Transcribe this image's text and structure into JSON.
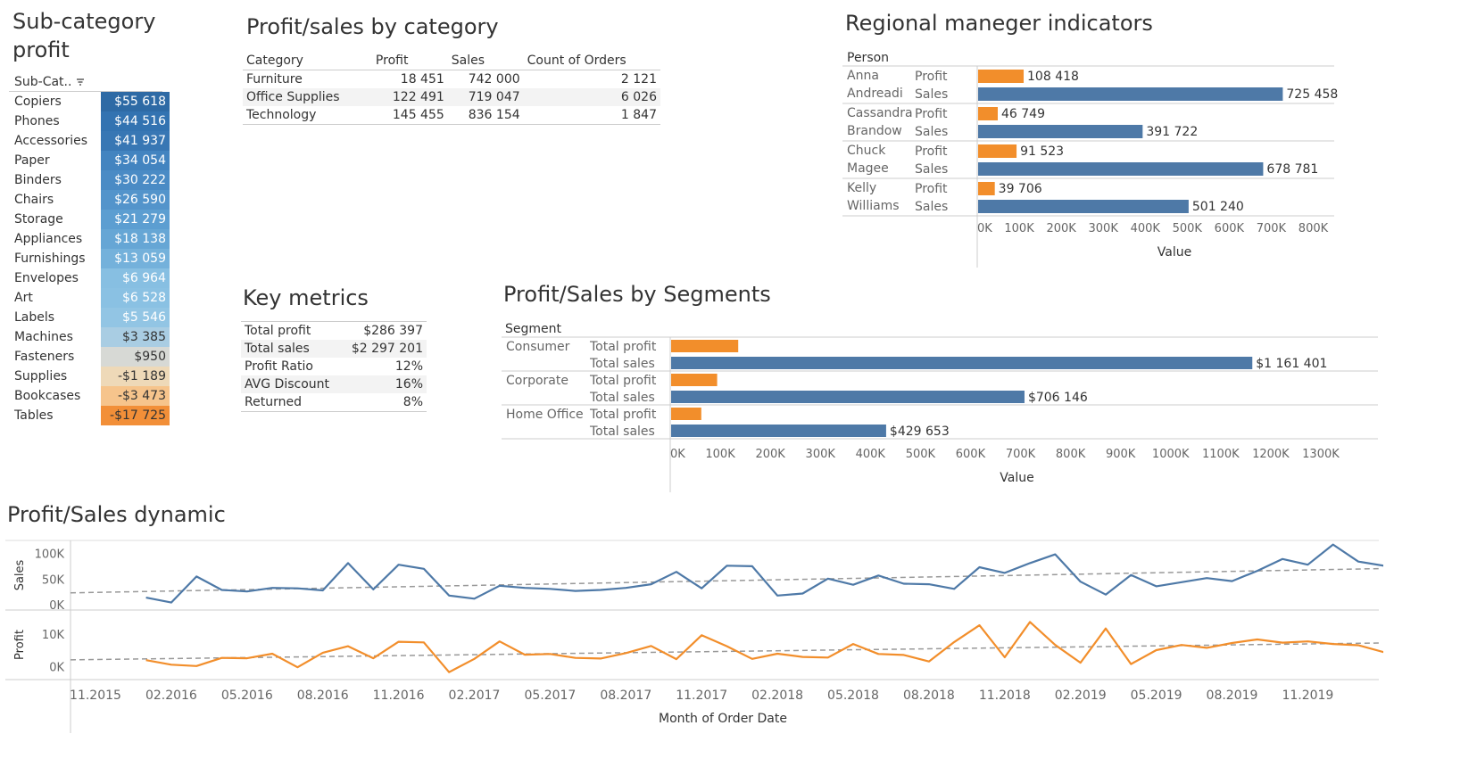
{
  "subcategory": {
    "title_line1": "Sub-category",
    "title_line2": "profit",
    "header": "Sub-Cat..",
    "items": [
      {
        "name": "Copiers",
        "value": "$55 618",
        "color": "#2e6aa5"
      },
      {
        "name": "Phones",
        "value": "$44 516",
        "color": "#3373b1"
      },
      {
        "name": "Accessories",
        "value": "$41 937",
        "color": "#3877b4"
      },
      {
        "name": "Paper",
        "value": "$34 054",
        "color": "#4384c0"
      },
      {
        "name": "Binders",
        "value": "$30 222",
        "color": "#4a8bc5"
      },
      {
        "name": "Chairs",
        "value": "$26 590",
        "color": "#5394cb"
      },
      {
        "name": "Storage",
        "value": "$21 279",
        "color": "#5c9ed1"
      },
      {
        "name": "Appliances",
        "value": "$18 138",
        "color": "#66a6d5"
      },
      {
        "name": "Furnishings",
        "value": "$13 059",
        "color": "#74b1db"
      },
      {
        "name": "Envelopes",
        "value": "$6 964",
        "color": "#87bfe2"
      },
      {
        "name": "Art",
        "value": "$6 528",
        "color": "#8ac1e3"
      },
      {
        "name": "Labels",
        "value": "$5 546",
        "color": "#92c5e4"
      },
      {
        "name": "Machines",
        "value": "$3 385",
        "color": "#a9cde3"
      },
      {
        "name": "Fasteners",
        "value": "$950",
        "color": "#d7d9d5"
      },
      {
        "name": "Supplies",
        "value": "-$1 189",
        "color": "#eed9b8"
      },
      {
        "name": "Bookcases",
        "value": "-$3 473",
        "color": "#f6c48c"
      },
      {
        "name": "Tables",
        "value": "-$17 725",
        "color": "#f28f38"
      }
    ]
  },
  "category": {
    "title": "Profit/sales by category",
    "headers": [
      "Category",
      "Profit",
      "Sales",
      "Count of Orders"
    ],
    "rows": [
      [
        "Furniture",
        "18 451",
        "742 000",
        "2 121"
      ],
      [
        "Office Supplies",
        "122 491",
        "719 047",
        "6 026"
      ],
      [
        "Technology",
        "145 455",
        "836 154",
        "1 847"
      ]
    ]
  },
  "key_metrics": {
    "title": "Key metrics",
    "rows": [
      [
        "Total profit",
        "$286 397"
      ],
      [
        "Total sales",
        "$2 297 201"
      ],
      [
        "Profit Ratio",
        "12%"
      ],
      [
        "AVG Discount",
        "16%"
      ],
      [
        "Returned",
        "8%"
      ]
    ]
  },
  "colors": {
    "profit": "#f28e2b",
    "sales": "#4e79a7",
    "trend": "#999999"
  },
  "chart_data": [
    {
      "type": "bar",
      "title": "Regional maneger indicators",
      "row_header": "Person",
      "xlabel": "Value",
      "xlim": [
        0,
        850000
      ],
      "ticks": [
        "0K",
        "100K",
        "200K",
        "300K",
        "400K",
        "500K",
        "600K",
        "700K",
        "800K"
      ],
      "tick_values": [
        0,
        100000,
        200000,
        300000,
        400000,
        500000,
        600000,
        700000,
        800000
      ],
      "groups": [
        {
          "first": "Anna",
          "last": "Andreadi",
          "bars": [
            {
              "measure": "Profit",
              "value": 108418,
              "label": "108 418"
            },
            {
              "measure": "Sales",
              "value": 725458,
              "label": "725 458"
            }
          ]
        },
        {
          "first": "Cassandra",
          "last": "Brandow",
          "bars": [
            {
              "measure": "Profit",
              "value": 46749,
              "label": "46 749"
            },
            {
              "measure": "Sales",
              "value": 391722,
              "label": "391 722"
            }
          ]
        },
        {
          "first": "Chuck",
          "last": "Magee",
          "bars": [
            {
              "measure": "Profit",
              "value": 91523,
              "label": "91 523"
            },
            {
              "measure": "Sales",
              "value": 678781,
              "label": "678 781"
            }
          ]
        },
        {
          "first": "Kelly",
          "last": "Williams",
          "bars": [
            {
              "measure": "Profit",
              "value": 39706,
              "label": "39 706"
            },
            {
              "measure": "Sales",
              "value": 501240,
              "label": "501 240"
            }
          ]
        }
      ]
    },
    {
      "type": "bar",
      "title": "Profit/Sales by Segments",
      "row_header": "Segment",
      "xlabel": "Value",
      "xlim": [
        0,
        1350000
      ],
      "ticks": [
        "0K",
        "100K",
        "200K",
        "300K",
        "400K",
        "500K",
        "600K",
        "700K",
        "800K",
        "900K",
        "1000K",
        "1100K",
        "1200K",
        "1300K"
      ],
      "tick_values": [
        0,
        100000,
        200000,
        300000,
        400000,
        500000,
        600000,
        700000,
        800000,
        900000,
        1000000,
        1100000,
        1200000,
        1300000
      ],
      "groups": [
        {
          "name": "Consumer",
          "bars": [
            {
              "measure": "Total profit",
              "value": 134119,
              "label": ""
            },
            {
              "measure": "Total sales",
              "value": 1161401,
              "label": "$1 161 401"
            }
          ]
        },
        {
          "name": "Corporate",
          "bars": [
            {
              "measure": "Total profit",
              "value": 91979,
              "label": ""
            },
            {
              "measure": "Total sales",
              "value": 706146,
              "label": "$706 146"
            }
          ]
        },
        {
          "name": "Home Office",
          "bars": [
            {
              "measure": "Total profit",
              "value": 60299,
              "label": ""
            },
            {
              "measure": "Total sales",
              "value": 429653,
              "label": "$429 653"
            }
          ]
        }
      ]
    },
    {
      "type": "line",
      "title": "Profit/Sales dynamic",
      "xlabel": "Month of Order Date",
      "x_ticks": [
        "11.2015",
        "02.2016",
        "05.2016",
        "08.2016",
        "11.2016",
        "02.2017",
        "05.2017",
        "08.2017",
        "11.2017",
        "02.2018",
        "05.2018",
        "08.2018",
        "11.2018",
        "02.2019",
        "05.2019",
        "08.2019",
        "11.2019"
      ],
      "x_start": "01.2016",
      "series": [
        {
          "name": "Sales",
          "axis_label": "Sales",
          "ylim": [
            -10000,
            125000
          ],
          "ticks": [
            "100K",
            "50K",
            "0K"
          ],
          "tick_values": [
            100000,
            50000,
            0
          ],
          "values": [
            14000,
            4500,
            55000,
            29000,
            26000,
            33000,
            32000,
            28000,
            81000,
            30000,
            78000,
            70000,
            18000,
            12000,
            37000,
            33000,
            31000,
            27000,
            29000,
            33000,
            40000,
            64000,
            32000,
            76000,
            75000,
            18000,
            22000,
            51000,
            39000,
            57000,
            41000,
            40000,
            31000,
            73000,
            62000,
            81000,
            98000,
            45000,
            20000,
            58000,
            36000,
            44000,
            52000,
            46000,
            66000,
            89000,
            78000,
            117000,
            84000,
            76000
          ]
        },
        {
          "name": "Profit",
          "axis_label": "Profit",
          "ylim": [
            -4000,
            17500
          ],
          "ticks": [
            "10K",
            "0K"
          ],
          "tick_values": [
            10000,
            0
          ],
          "values": [
            2000,
            600,
            200,
            2700,
            2600,
            4000,
            -200,
            4300,
            6300,
            2600,
            7700,
            7500,
            -1700,
            2400,
            7800,
            3700,
            3900,
            2700,
            2500,
            4200,
            6400,
            2300,
            9700,
            6300,
            2400,
            4000,
            3000,
            2800,
            7000,
            3900,
            3600,
            1600,
            7600,
            12800,
            2900,
            13800,
            6700,
            1200,
            11800,
            800,
            5100,
            6700,
            5800,
            7300,
            8400,
            7400,
            7800,
            7000,
            6600,
            4500
          ]
        }
      ]
    }
  ]
}
